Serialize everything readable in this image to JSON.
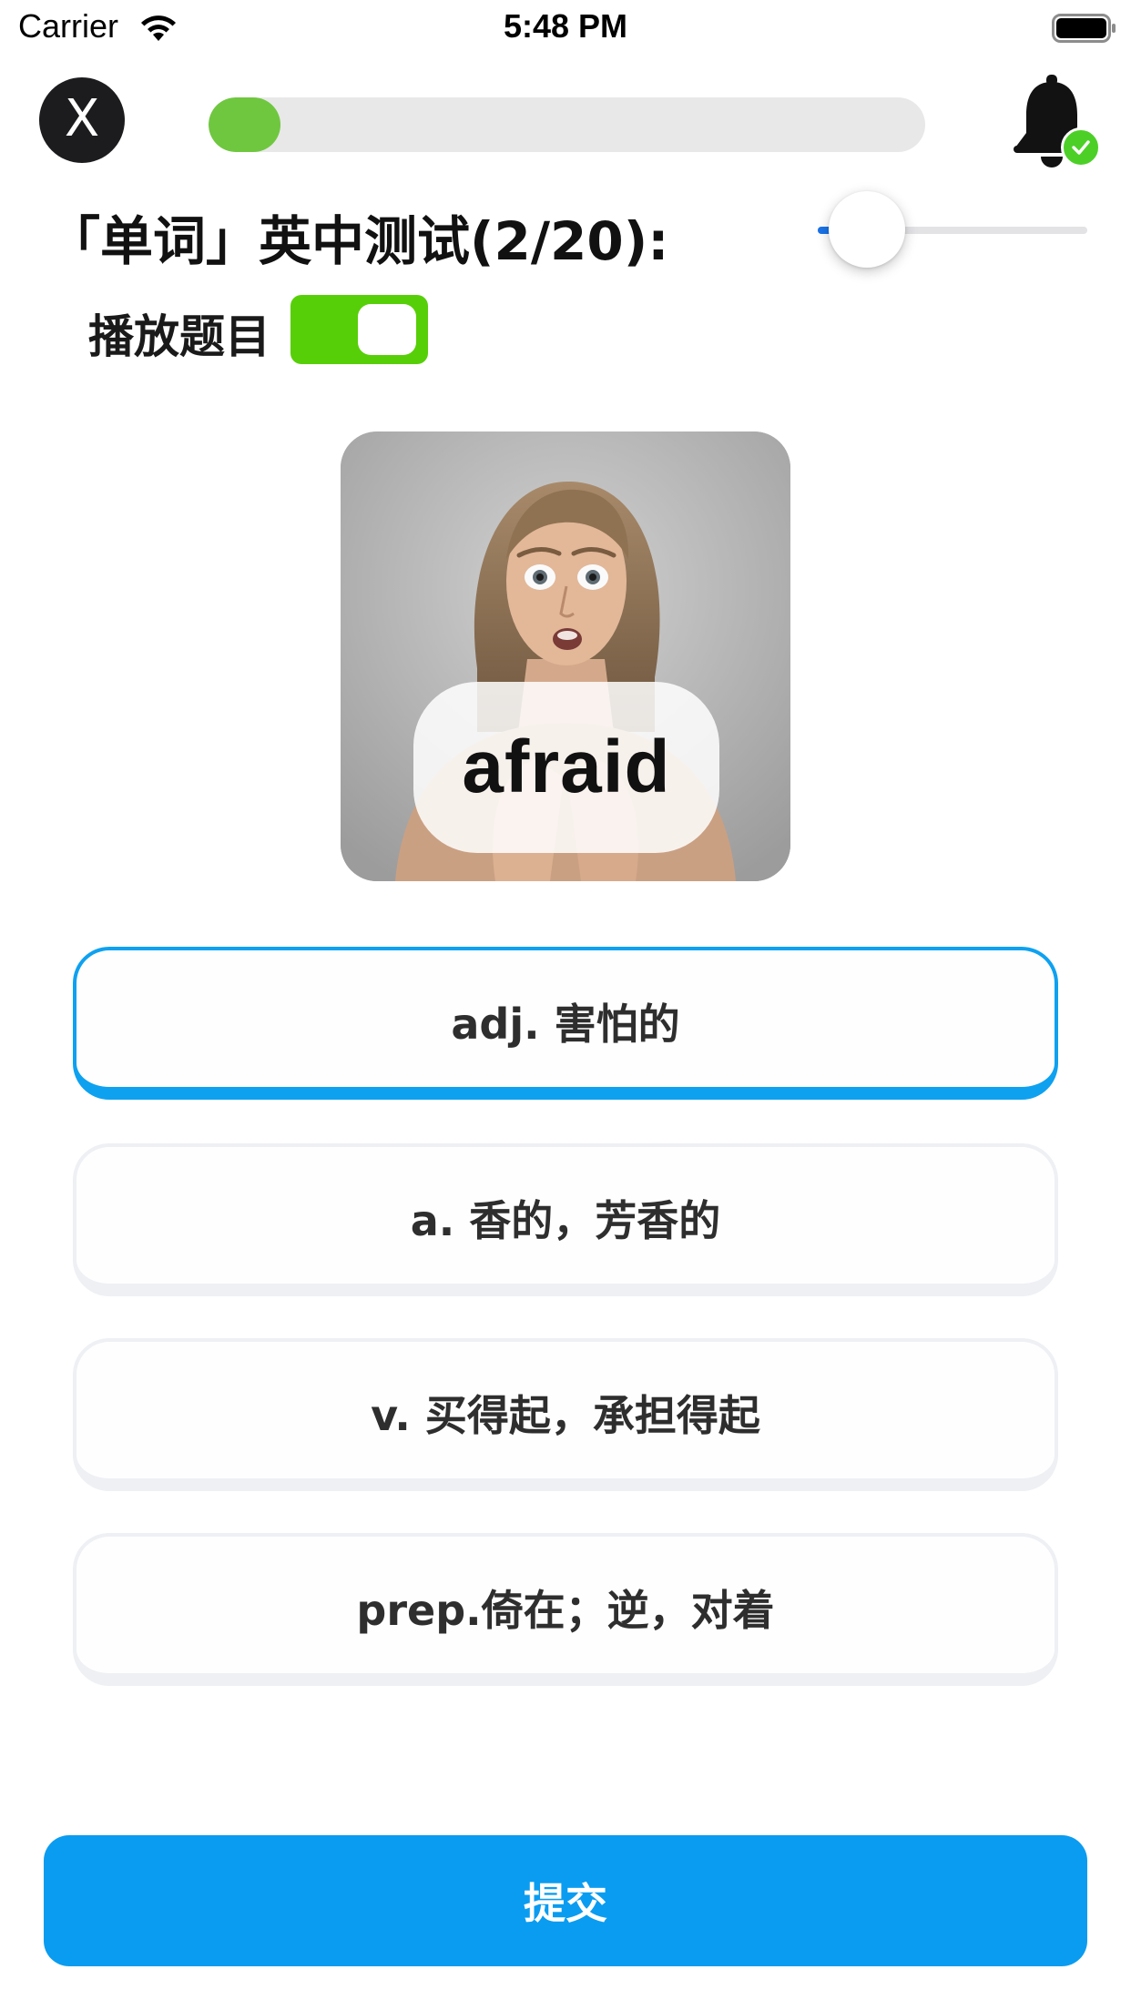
{
  "status_bar": {
    "carrier": "Carrier",
    "time": "5:48 PM",
    "icons": [
      "wifi-icon",
      "battery-icon"
    ]
  },
  "top_bar": {
    "close_label": "X",
    "progress": 0.1,
    "bell_icon": "bell-icon",
    "bell_badge_icon": "check-icon",
    "colors": {
      "progress_fill": "#6fc73f",
      "progress_track": "#e8e8e8",
      "badge": "#4cd027"
    }
  },
  "quiz": {
    "title": "「单词」英中测试(2/20):",
    "speed_slider_value": 0.04
  },
  "play_toggle": {
    "label": "播放题目",
    "on": true,
    "color": "#57cf08"
  },
  "word_card": {
    "word": "afraid",
    "image": "photo of a frightened woman"
  },
  "options": [
    {
      "label": "adj. 害怕的",
      "selected": true
    },
    {
      "label": "a. 香的，芳香的",
      "selected": false
    },
    {
      "label": "v. 买得起，承担得起",
      "selected": false
    },
    {
      "label": "prep.倚在；逆，对着",
      "selected": false
    }
  ],
  "submit": {
    "label": "提交",
    "color": "#0a9cf0"
  },
  "colors": {
    "selected_border": "#0ea1f0",
    "option_border": "#eef0f4"
  }
}
